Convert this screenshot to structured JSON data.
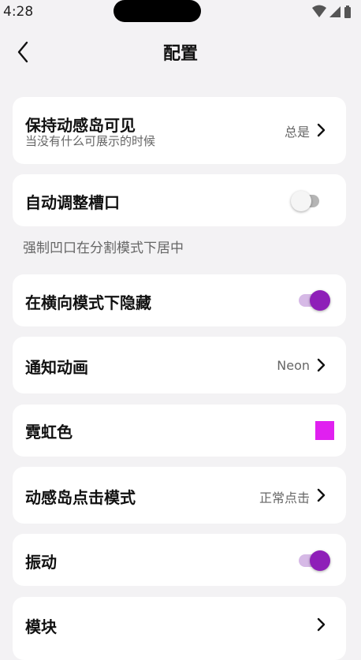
{
  "status_bar": {
    "time": "4:28",
    "icons": [
      "wifi-icon",
      "signal-icon",
      "battery-icon"
    ]
  },
  "header": {
    "back_icon": "chevron-left-icon",
    "title": "配置"
  },
  "settings": {
    "keep_visible": {
      "label": "保持动感岛可见",
      "sublabel": "当没有什么可展示的时候",
      "value": "总是"
    },
    "auto_adjust_slot": {
      "label": "自动调整槽口",
      "enabled": false
    },
    "split_note": "强制凹口在分割模式下居中",
    "hide_landscape": {
      "label": "在横向模式下隐藏",
      "enabled": true
    },
    "notification_animation": {
      "label": "通知动画",
      "value": "Neon"
    },
    "neon_color": {
      "label": "霓虹色",
      "color": "#e020f0"
    },
    "click_mode": {
      "label": "动感岛点击模式",
      "value": "正常点击"
    },
    "vibration": {
      "label": "振动",
      "enabled": true
    },
    "modules": {
      "label": "模块"
    }
  },
  "colors": {
    "accent": "#8e1fb8",
    "accent_track": "#d6b9e6",
    "background": "#f3f2f4",
    "card": "#ffffff"
  }
}
